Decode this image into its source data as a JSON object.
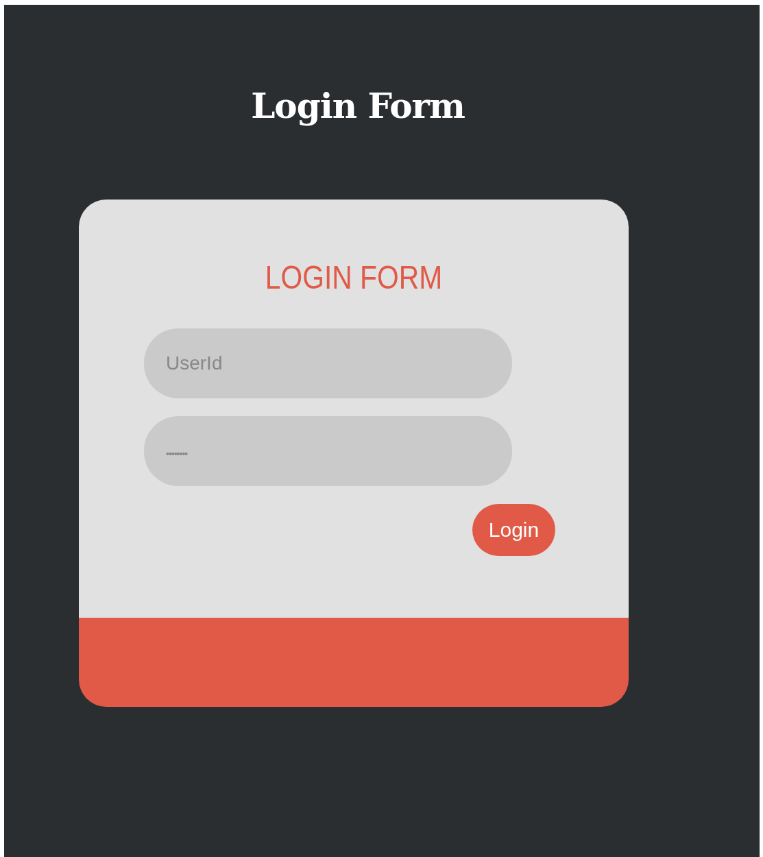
{
  "page_title": "Login Form",
  "form": {
    "heading": "LOGIN FORM",
    "fields": [
      {
        "kind": "text",
        "placeholder": "UserId"
      },
      {
        "kind": "password",
        "placeholder": "••••••••"
      }
    ],
    "submit": "Login"
  }
}
